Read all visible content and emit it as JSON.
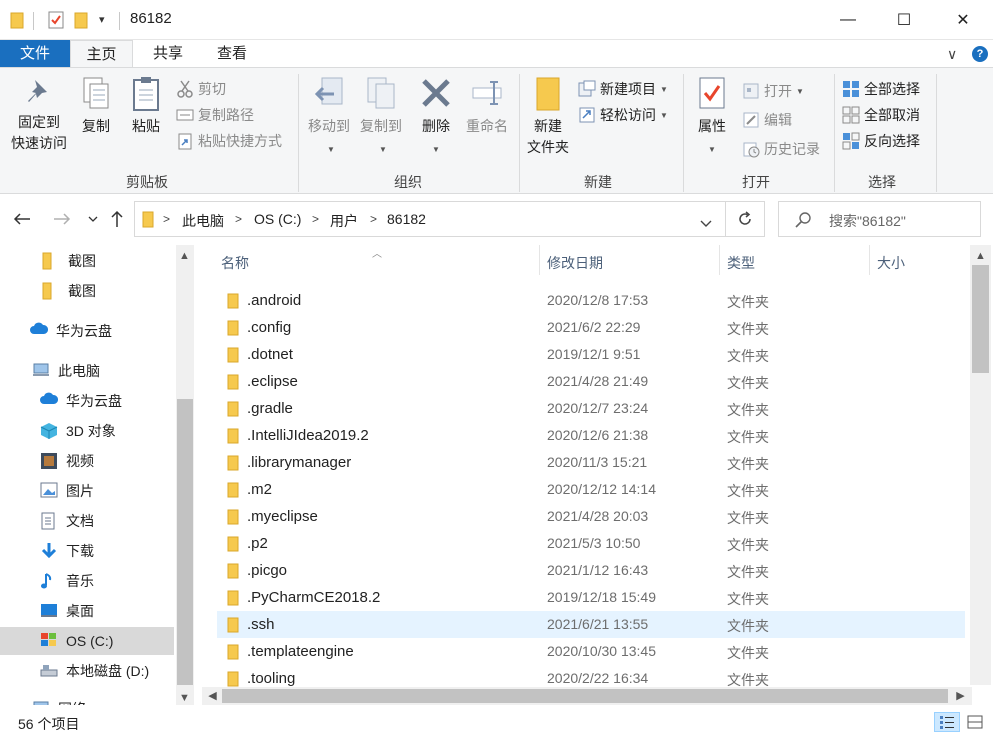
{
  "window": {
    "title": "86182",
    "minimize": "—",
    "maximize": "☐",
    "close": "✕"
  },
  "ribbon_tabs": {
    "file": "文件",
    "home": "主页",
    "share": "共享",
    "view": "查看"
  },
  "ribbon_controls": {
    "collapse": "∨",
    "help": "?"
  },
  "clipboard": {
    "group": "剪贴板",
    "pin_line1": "固定到",
    "pin_line2": "快速访问",
    "copy": "复制",
    "paste": "粘贴",
    "cut": "剪切",
    "copy_path": "复制路径",
    "paste_shortcut": "粘贴快捷方式"
  },
  "organize": {
    "group": "组织",
    "move_to": "移动到",
    "copy_to": "复制到",
    "delete": "删除",
    "rename": "重命名"
  },
  "new": {
    "group": "新建",
    "new_folder_line1": "新建",
    "new_folder_line2": "文件夹",
    "new_item": "新建项目",
    "easy_access": "轻松访问"
  },
  "open": {
    "group": "打开",
    "properties": "属性",
    "open": "打开",
    "edit": "编辑",
    "history": "历史记录"
  },
  "select": {
    "group": "选择",
    "select_all": "全部选择",
    "select_none": "全部取消",
    "invert": "反向选择"
  },
  "address": {
    "crumbs": [
      "此电脑",
      "OS (C:)",
      "用户",
      "86182"
    ],
    "search_placeholder": "搜索\"86182\""
  },
  "nav": {
    "items": [
      {
        "label": "截图",
        "icon": "folder-icon"
      },
      {
        "label": "截图",
        "icon": "folder-icon"
      },
      {
        "label": "华为云盘",
        "icon": "cloud-icon"
      },
      {
        "label": "此电脑",
        "icon": "pc-icon"
      },
      {
        "label": "华为云盘",
        "icon": "cloud-icon"
      },
      {
        "label": "3D 对象",
        "icon": "cube-icon"
      },
      {
        "label": "视频",
        "icon": "video-icon"
      },
      {
        "label": "图片",
        "icon": "picture-icon"
      },
      {
        "label": "文档",
        "icon": "document-icon"
      },
      {
        "label": "下载",
        "icon": "download-icon"
      },
      {
        "label": "音乐",
        "icon": "music-icon"
      },
      {
        "label": "桌面",
        "icon": "desktop-icon"
      },
      {
        "label": "OS (C:)",
        "icon": "drive-c-icon"
      },
      {
        "label": "本地磁盘 (D:)",
        "icon": "drive-icon"
      },
      {
        "label": "网络",
        "icon": "network-icon"
      }
    ]
  },
  "columns": {
    "name": "名称",
    "modified": "修改日期",
    "type": "类型",
    "size": "大小"
  },
  "files": [
    {
      "name": ".android",
      "date": "2020/12/8 17:53",
      "type": "文件夹"
    },
    {
      "name": ".config",
      "date": "2021/6/2 22:29",
      "type": "文件夹"
    },
    {
      "name": ".dotnet",
      "date": "2019/12/1 9:51",
      "type": "文件夹"
    },
    {
      "name": ".eclipse",
      "date": "2021/4/28 21:49",
      "type": "文件夹"
    },
    {
      "name": ".gradle",
      "date": "2020/12/7 23:24",
      "type": "文件夹"
    },
    {
      "name": ".IntelliJIdea2019.2",
      "date": "2020/12/6 21:38",
      "type": "文件夹"
    },
    {
      "name": ".librarymanager",
      "date": "2020/11/3 15:21",
      "type": "文件夹"
    },
    {
      "name": ".m2",
      "date": "2020/12/12 14:14",
      "type": "文件夹"
    },
    {
      "name": ".myeclipse",
      "date": "2021/4/28 20:03",
      "type": "文件夹"
    },
    {
      "name": ".p2",
      "date": "2021/5/3 10:50",
      "type": "文件夹"
    },
    {
      "name": ".picgo",
      "date": "2021/1/12 16:43",
      "type": "文件夹"
    },
    {
      "name": ".PyCharmCE2018.2",
      "date": "2019/12/18 15:49",
      "type": "文件夹"
    },
    {
      "name": ".ssh",
      "date": "2021/6/21 13:55",
      "type": "文件夹"
    },
    {
      "name": ".templateengine",
      "date": "2020/10/30 13:45",
      "type": "文件夹"
    },
    {
      "name": ".tooling",
      "date": "2020/2/22 16:34",
      "type": "文件夹"
    }
  ],
  "status": {
    "count": "56 个项目"
  },
  "colors": {
    "accent": "#1a6fbf",
    "folder": "#f6c94e",
    "hover_row": "#e5f3ff"
  }
}
